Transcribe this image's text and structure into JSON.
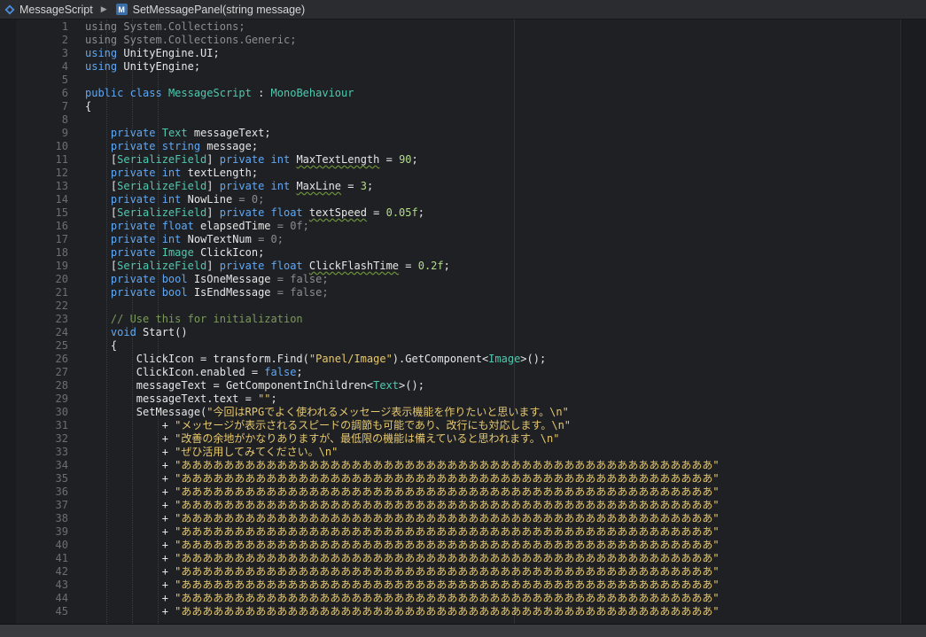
{
  "breadcrumb": {
    "file": "MessageScript",
    "method_badge": "M",
    "method": "SetMessagePanel(string message)"
  },
  "editor": {
    "line_numbers": [
      "1",
      "2",
      "3",
      "4",
      "5",
      "6",
      "7",
      "8",
      "9",
      "10",
      "11",
      "12",
      "13",
      "14",
      "15",
      "16",
      "17",
      "18",
      "19",
      "20",
      "21",
      "22",
      "23",
      "24",
      "25",
      "26",
      "27",
      "28",
      "29",
      "30",
      "31",
      "32",
      "33",
      "34",
      "35",
      "36",
      "37",
      "38",
      "39",
      "40",
      "41",
      "42",
      "43",
      "44",
      "45"
    ],
    "lines": [
      [
        {
          "t": "using System.Collections;",
          "c": "dim"
        }
      ],
      [
        {
          "t": "using System.Collections.Generic;",
          "c": "dim"
        }
      ],
      [
        {
          "t": "using",
          "c": "kw"
        },
        {
          "t": " UnityEngine.UI;"
        }
      ],
      [
        {
          "t": "using",
          "c": "kw"
        },
        {
          "t": " UnityEngine;"
        }
      ],
      [],
      [
        {
          "t": "public class",
          "c": "kw"
        },
        {
          "t": " "
        },
        {
          "t": "MessageScript",
          "c": "ty"
        },
        {
          "t": " : "
        },
        {
          "t": "MonoBehaviour",
          "c": "ty"
        }
      ],
      [
        {
          "t": "{"
        }
      ],
      [],
      [
        {
          "t": "    "
        },
        {
          "t": "private",
          "c": "kw"
        },
        {
          "t": " "
        },
        {
          "t": "Text",
          "c": "ty"
        },
        {
          "t": " messageText;"
        }
      ],
      [
        {
          "t": "    "
        },
        {
          "t": "private string",
          "c": "kw"
        },
        {
          "t": " message;"
        }
      ],
      [
        {
          "t": "    ["
        },
        {
          "t": "SerializeField",
          "c": "ty"
        },
        {
          "t": "] "
        },
        {
          "t": "private int",
          "c": "kw"
        },
        {
          "t": " "
        },
        {
          "t": "MaxTextLength",
          "c": "squig"
        },
        {
          "t": " = "
        },
        {
          "t": "90",
          "c": "num"
        },
        {
          "t": ";"
        }
      ],
      [
        {
          "t": "    "
        },
        {
          "t": "private int",
          "c": "kw"
        },
        {
          "t": " textLength;"
        }
      ],
      [
        {
          "t": "    ["
        },
        {
          "t": "SerializeField",
          "c": "ty"
        },
        {
          "t": "] "
        },
        {
          "t": "private int",
          "c": "kw"
        },
        {
          "t": " "
        },
        {
          "t": "MaxLine",
          "c": "squig"
        },
        {
          "t": " = "
        },
        {
          "t": "3",
          "c": "num"
        },
        {
          "t": ";"
        }
      ],
      [
        {
          "t": "    "
        },
        {
          "t": "private int",
          "c": "kw"
        },
        {
          "t": " NowLine "
        },
        {
          "t": "= 0;",
          "c": "dim"
        }
      ],
      [
        {
          "t": "    ["
        },
        {
          "t": "SerializeField",
          "c": "ty"
        },
        {
          "t": "] "
        },
        {
          "t": "private float",
          "c": "kw"
        },
        {
          "t": " "
        },
        {
          "t": "textSpeed",
          "c": "squig"
        },
        {
          "t": " = "
        },
        {
          "t": "0.05f",
          "c": "num"
        },
        {
          "t": ";"
        }
      ],
      [
        {
          "t": "    "
        },
        {
          "t": "private float",
          "c": "kw"
        },
        {
          "t": " elapsedTime "
        },
        {
          "t": "= 0f;",
          "c": "dim"
        }
      ],
      [
        {
          "t": "    "
        },
        {
          "t": "private int",
          "c": "kw"
        },
        {
          "t": " NowTextNum "
        },
        {
          "t": "= 0;",
          "c": "dim"
        }
      ],
      [
        {
          "t": "    "
        },
        {
          "t": "private",
          "c": "kw"
        },
        {
          "t": " "
        },
        {
          "t": "Image",
          "c": "ty"
        },
        {
          "t": " ClickIcon;"
        }
      ],
      [
        {
          "t": "    ["
        },
        {
          "t": "SerializeField",
          "c": "ty"
        },
        {
          "t": "] "
        },
        {
          "t": "private float",
          "c": "kw"
        },
        {
          "t": " "
        },
        {
          "t": "ClickFlashTime",
          "c": "squig"
        },
        {
          "t": " = "
        },
        {
          "t": "0.2f",
          "c": "num"
        },
        {
          "t": ";"
        }
      ],
      [
        {
          "t": "    "
        },
        {
          "t": "private bool",
          "c": "kw"
        },
        {
          "t": " IsOneMessage "
        },
        {
          "t": "= false;",
          "c": "dim"
        }
      ],
      [
        {
          "t": "    "
        },
        {
          "t": "private bool",
          "c": "kw"
        },
        {
          "t": " IsEndMessage "
        },
        {
          "t": "= false;",
          "c": "dim"
        }
      ],
      [],
      [
        {
          "t": "    "
        },
        {
          "t": "// Use this for initialization",
          "c": "cmt"
        }
      ],
      [
        {
          "t": "    "
        },
        {
          "t": "void",
          "c": "kw"
        },
        {
          "t": " Start()"
        }
      ],
      [
        {
          "t": "    {"
        }
      ],
      [
        {
          "t": "        ClickIcon = transform.Find("
        },
        {
          "t": "\"Panel/Image\"",
          "c": "str"
        },
        {
          "t": ").GetComponent<"
        },
        {
          "t": "Image",
          "c": "ty"
        },
        {
          "t": ">();"
        }
      ],
      [
        {
          "t": "        ClickIcon.enabled = "
        },
        {
          "t": "false",
          "c": "kw"
        },
        {
          "t": ";"
        }
      ],
      [
        {
          "t": "        messageText = GetComponentInChildren<"
        },
        {
          "t": "Text",
          "c": "ty"
        },
        {
          "t": ">();"
        }
      ],
      [
        {
          "t": "        messageText.text = "
        },
        {
          "t": "\"\"",
          "c": "str"
        },
        {
          "t": ";"
        }
      ],
      [
        {
          "t": "        SetMessage("
        },
        {
          "t": "\"今回はRPGでよく使われるメッセージ表示機能を作りたいと思います。\\n\"",
          "c": "str"
        }
      ],
      [
        {
          "t": "            + "
        },
        {
          "t": "\"メッセージが表示されるスピードの調節も可能であり、改行にも対応します。\\n\"",
          "c": "str"
        }
      ],
      [
        {
          "t": "            + "
        },
        {
          "t": "\"改善の余地がかなりありますが、最低限の機能は備えていると思われます。\\n\"",
          "c": "str"
        }
      ],
      [
        {
          "t": "            + "
        },
        {
          "t": "\"ぜひ活用してみてください。\\n\"",
          "c": "str"
        }
      ],
      [
        {
          "t": "            + "
        },
        {
          "t": "\"ああああああああああああああああああああああああああああああああああああああああああああああああああ\"",
          "c": "str"
        }
      ],
      [
        {
          "t": "            + "
        },
        {
          "t": "\"ああああああああああああああああああああああああああああああああああああああああああああああああああ\"",
          "c": "str"
        }
      ],
      [
        {
          "t": "            + "
        },
        {
          "t": "\"ああああああああああああああああああああああああああああああああああああああああああああああああああ\"",
          "c": "str"
        }
      ],
      [
        {
          "t": "            + "
        },
        {
          "t": "\"ああああああああああああああああああああああああああああああああああああああああああああああああああ\"",
          "c": "str"
        }
      ],
      [
        {
          "t": "            + "
        },
        {
          "t": "\"ああああああああああああああああああああああああああああああああああああああああああああああああああ\"",
          "c": "str"
        }
      ],
      [
        {
          "t": "            + "
        },
        {
          "t": "\"ああああああああああああああああああああああああああああああああああああああああああああああああああ\"",
          "c": "str"
        }
      ],
      [
        {
          "t": "            + "
        },
        {
          "t": "\"ああああああああああああああああああああああああああああああああああああああああああああああああああ\"",
          "c": "str"
        }
      ],
      [
        {
          "t": "            + "
        },
        {
          "t": "\"ああああああああああああああああああああああああああああああああああああああああああああああああああ\"",
          "c": "str"
        }
      ],
      [
        {
          "t": "            + "
        },
        {
          "t": "\"ああああああああああああああああああああああああああああああああああああああああああああああああああ\"",
          "c": "str"
        }
      ],
      [
        {
          "t": "            + "
        },
        {
          "t": "\"ああああああああああああああああああああああああああああああああああああああああああああああああああ\"",
          "c": "str"
        }
      ],
      [
        {
          "t": "            + "
        },
        {
          "t": "\"ああああああああああああああああああああああああああああああああああああああああああああああああああ\"",
          "c": "str"
        }
      ],
      [
        {
          "t": "            + "
        },
        {
          "t": "\"ああああああああああああああああああああああああああああああああああああああああああああああああああ\"",
          "c": "str"
        }
      ]
    ]
  },
  "colors": {
    "keyword": "#5fa8f5",
    "type": "#4ec9b0",
    "number": "#b4dc8a",
    "string": "#e6c86e",
    "comment": "#7a9a5c",
    "background": "#1f2023"
  },
  "icons": {
    "file": "csharp-file-icon",
    "separator": "chevron-right-icon",
    "method": "method-icon"
  }
}
